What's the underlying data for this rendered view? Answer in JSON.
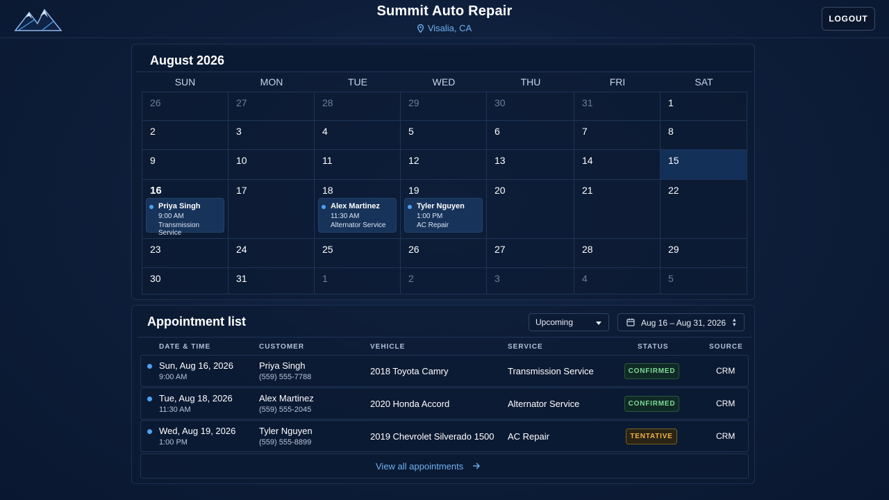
{
  "header": {
    "title": "Summit Auto Repair",
    "location": "Visalia, CA",
    "logout_label": "LOGOUT",
    "logo_icon": "mountain-logo-icon"
  },
  "calendar": {
    "month_title": "August 2026",
    "weekdays": [
      "SUN",
      "MON",
      "TUE",
      "WED",
      "THU",
      "FRI",
      "SAT"
    ],
    "weeks": [
      [
        {
          "d": "26",
          "m": true
        },
        {
          "d": "27",
          "m": true
        },
        {
          "d": "28",
          "m": true
        },
        {
          "d": "29",
          "m": true
        },
        {
          "d": "30",
          "m": true
        },
        {
          "d": "31",
          "m": true
        },
        {
          "d": "1"
        }
      ],
      [
        {
          "d": "2"
        },
        {
          "d": "3"
        },
        {
          "d": "4"
        },
        {
          "d": "5"
        },
        {
          "d": "6"
        },
        {
          "d": "7"
        },
        {
          "d": "8"
        }
      ],
      [
        {
          "d": "9"
        },
        {
          "d": "10"
        },
        {
          "d": "11"
        },
        {
          "d": "12"
        },
        {
          "d": "13"
        },
        {
          "d": "14"
        },
        {
          "d": "15",
          "selected": true
        }
      ],
      [
        {
          "d": "16",
          "today": true
        },
        {
          "d": "17"
        },
        {
          "d": "18"
        },
        {
          "d": "19"
        },
        {
          "d": "20"
        },
        {
          "d": "21"
        },
        {
          "d": "22"
        }
      ],
      [
        {
          "d": "23"
        },
        {
          "d": "24"
        },
        {
          "d": "25"
        },
        {
          "d": "26"
        },
        {
          "d": "27"
        },
        {
          "d": "28"
        },
        {
          "d": "29"
        }
      ],
      [
        {
          "d": "30"
        },
        {
          "d": "31"
        },
        {
          "d": "1",
          "m": true
        },
        {
          "d": "2",
          "m": true
        },
        {
          "d": "3",
          "m": true
        },
        {
          "d": "4",
          "m": true
        },
        {
          "d": "5",
          "m": true
        }
      ]
    ],
    "events": [
      {
        "week": 3,
        "day": 0,
        "name": "Priya Singh",
        "time": "9:00 AM",
        "service": "Transmission Service"
      },
      {
        "week": 3,
        "day": 2,
        "name": "Alex Martinez",
        "time": "11:30 AM",
        "service": "Alternator Service"
      },
      {
        "week": 3,
        "day": 3,
        "name": "Tyler Nguyen",
        "time": "1:00 PM",
        "service": "AC Repair"
      }
    ]
  },
  "appointments": {
    "title": "Appointment list",
    "filter_value": "Upcoming",
    "date_range": "Aug 16 – Aug 31, 2026",
    "columns": [
      "DATE & TIME",
      "CUSTOMER",
      "VEHICLE",
      "SERVICE",
      "STATUS",
      "SOURCE"
    ],
    "rows": [
      {
        "date": "Sun, Aug 16, 2026",
        "time": "9:00 AM",
        "customer": "Priya Singh",
        "phone": "(559) 555-7788",
        "vehicle": "2018 Toyota Camry",
        "service": "Transmission Service",
        "status": "CONFIRMED",
        "status_kind": "confirmed",
        "source": "CRM"
      },
      {
        "date": "Tue, Aug 18, 2026",
        "time": "11:30 AM",
        "customer": "Alex Martinez",
        "phone": "(559) 555-2045",
        "vehicle": "2020 Honda Accord",
        "service": "Alternator Service",
        "status": "CONFIRMED",
        "status_kind": "confirmed",
        "source": "CRM"
      },
      {
        "date": "Wed, Aug 19, 2026",
        "time": "1:00 PM",
        "customer": "Tyler Nguyen",
        "phone": "(559) 555-8899",
        "vehicle": "2019 Chevrolet Silverado 1500",
        "service": "AC Repair",
        "status": "TENTATIVE",
        "status_kind": "tentative",
        "source": "CRM"
      }
    ],
    "view_all_label": "View all appointments"
  },
  "colors": {
    "accent": "#4aa3f5",
    "link": "#6fb0f0",
    "confirmed": "#7fd99a",
    "tentative": "#f0b24a",
    "background": "#0d1d38"
  }
}
